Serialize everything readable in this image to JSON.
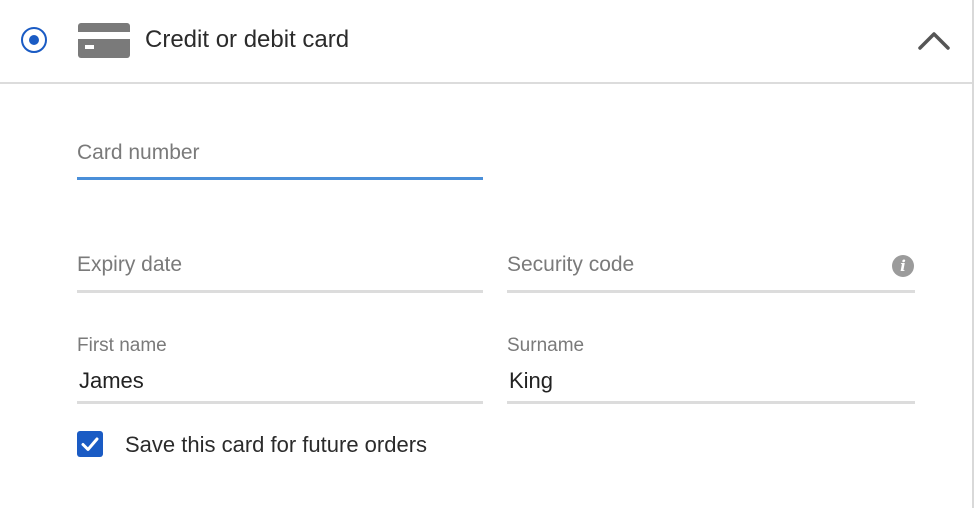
{
  "payment_option": {
    "title": "Credit or debit card",
    "selected": true,
    "expanded": true
  },
  "form": {
    "card_number": {
      "placeholder": "Card number",
      "value": ""
    },
    "expiry_date": {
      "placeholder": "Expiry date",
      "value": ""
    },
    "security_code": {
      "placeholder": "Security code",
      "value": "",
      "info_icon": "info-icon",
      "info_glyph": "i"
    },
    "first_name": {
      "label": "First name",
      "value": "James"
    },
    "surname": {
      "label": "Surname",
      "value": "King"
    }
  },
  "save_card": {
    "label": "Save this card for future orders",
    "checked": true
  },
  "colors": {
    "accent": "#1a5bc4",
    "focus_underline": "#4a8fd9",
    "border": "#dcdcdc",
    "text": "#2b2b2b",
    "muted": "#7a7a7a"
  },
  "icons": {
    "radio": "radio-selected-icon",
    "card": "credit-card-icon",
    "chevron": "chevron-up-icon",
    "checkbox": "checkmark-icon"
  }
}
